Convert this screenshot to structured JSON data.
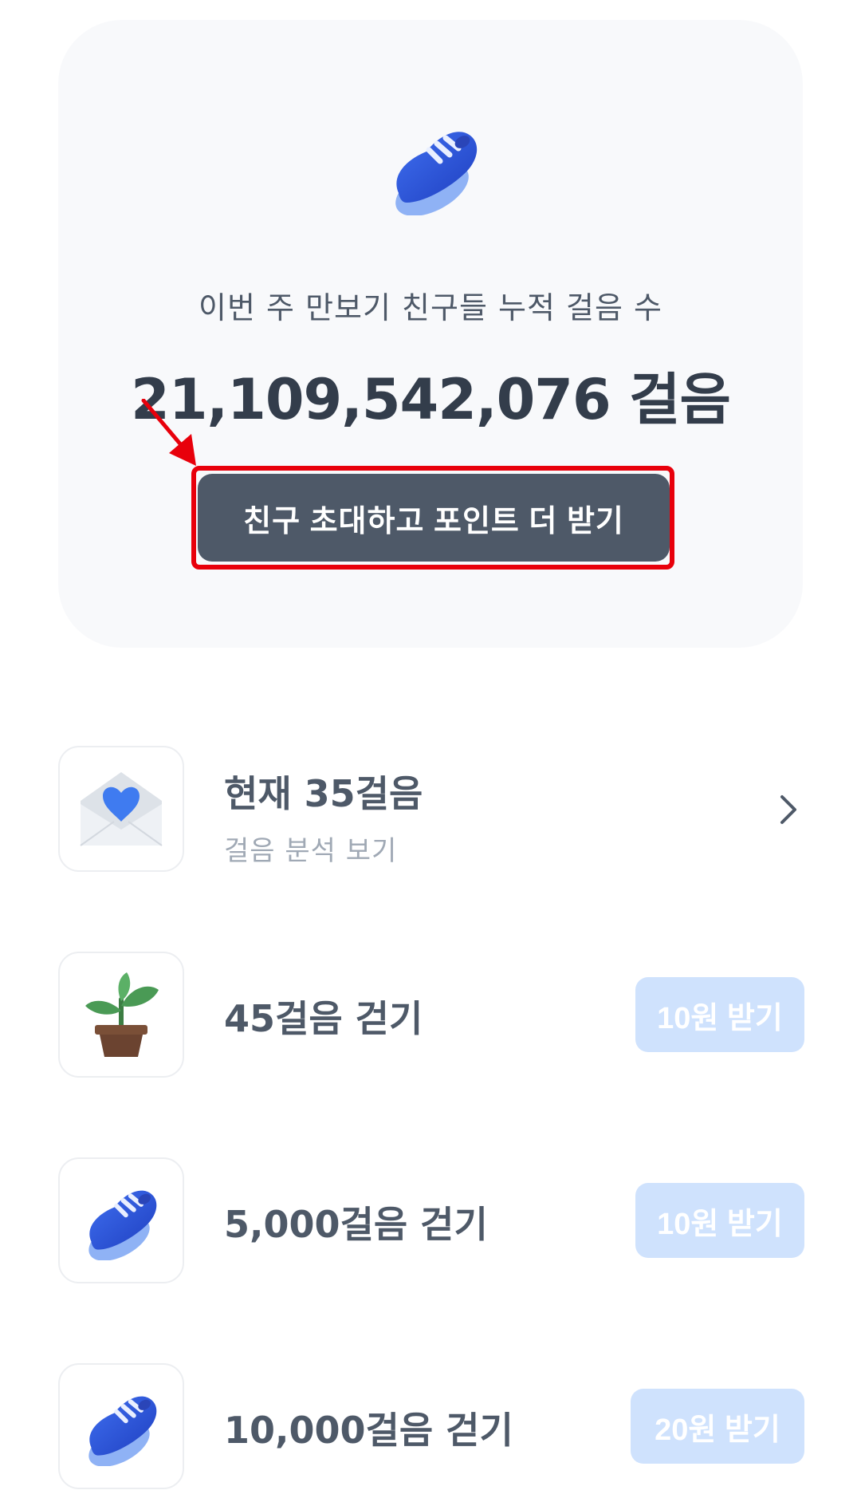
{
  "summary": {
    "caption": "이번 주 만보기 친구들 누적 걸음 수",
    "total_steps": "21,109,542,076 걸음",
    "invite_button_label": "친구 초대하고 포인트 더 받기",
    "hero_icon": "sneaker-icon",
    "highlight_color": "#e8000b"
  },
  "rows": [
    {
      "icon": "heart-envelope-icon",
      "title": "현재 35걸음",
      "subtitle": "걸음 분석 보기",
      "action_icon": "chevron-right-icon"
    },
    {
      "icon": "potted-plant-icon",
      "title": "45걸음 걷기",
      "reward_label": "10원 받기"
    },
    {
      "icon": "sneaker-icon",
      "title": "5,000걸음 걷기",
      "reward_label": "10원 받기"
    },
    {
      "icon": "sneaker-icon",
      "title": "10,000걸음 걷기",
      "reward_label": "20원 받기"
    }
  ],
  "colors": {
    "card_background": "#f8f9fb",
    "primary_button": "#4e5968",
    "reward_button_disabled": "#cfe2fd",
    "text_primary": "#333d4b",
    "text_secondary": "#a0a9b5"
  }
}
